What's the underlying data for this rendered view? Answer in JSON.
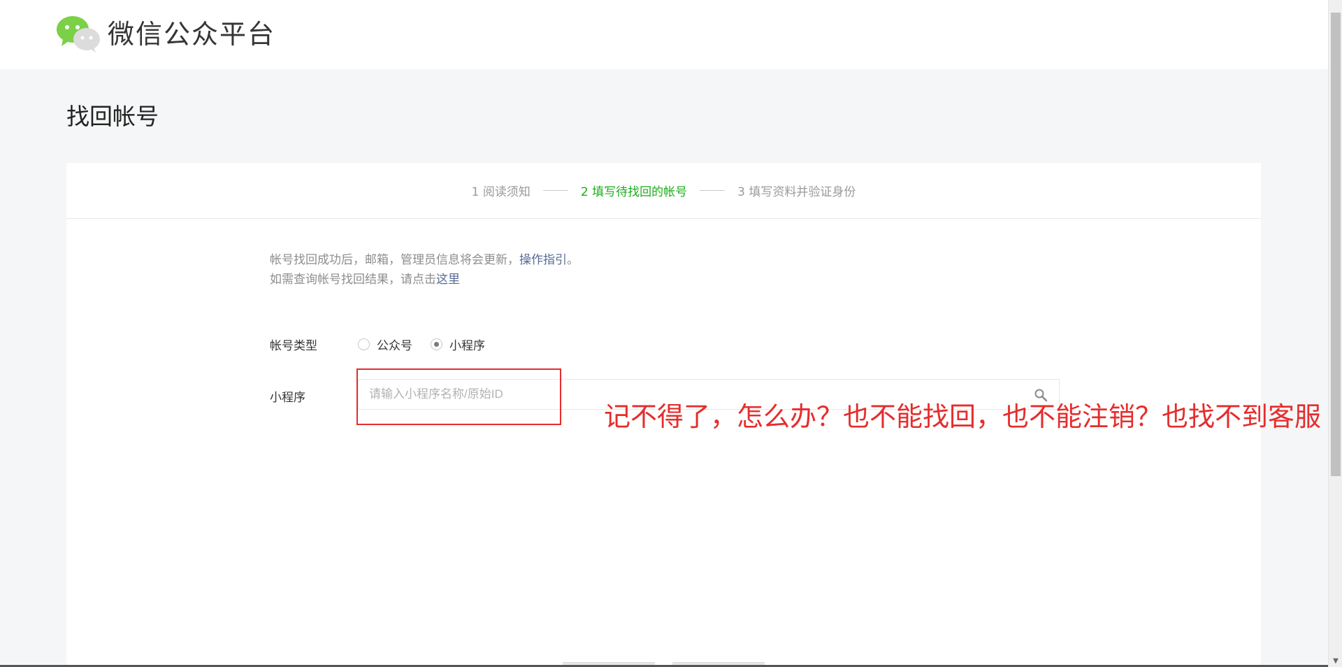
{
  "header": {
    "brand": "微信公众平台"
  },
  "page": {
    "title": "找回帐号"
  },
  "steps": [
    {
      "label": "1 阅读须知",
      "active": false
    },
    {
      "label": "2 填写待找回的帐号",
      "active": true
    },
    {
      "label": "3 填写资料并验证身份",
      "active": false
    }
  ],
  "notice": {
    "line1_text": "帐号找回成功后，邮箱，管理员信息将会更新，",
    "line1_link": "操作指引",
    "line1_end": "。",
    "line2_text": "如需查询帐号找回结果，请点击",
    "line2_link": "这里"
  },
  "form": {
    "account_type_label": "帐号类型",
    "options": [
      {
        "label": "公众号",
        "checked": false
      },
      {
        "label": "小程序",
        "checked": true
      }
    ],
    "miniprogram_label": "小程序",
    "search_placeholder": "请输入小程序名称/原始ID",
    "search_value": ""
  },
  "annotation": {
    "text": "记不得了，怎么办？也不能找回，也不能注销？也找不到客服"
  },
  "icons": {
    "logo": "wechat-logo-icon",
    "search": "search-icon"
  },
  "colors": {
    "accent": "#1aad19",
    "link": "#576b95",
    "annotation": "#e52d2d"
  }
}
